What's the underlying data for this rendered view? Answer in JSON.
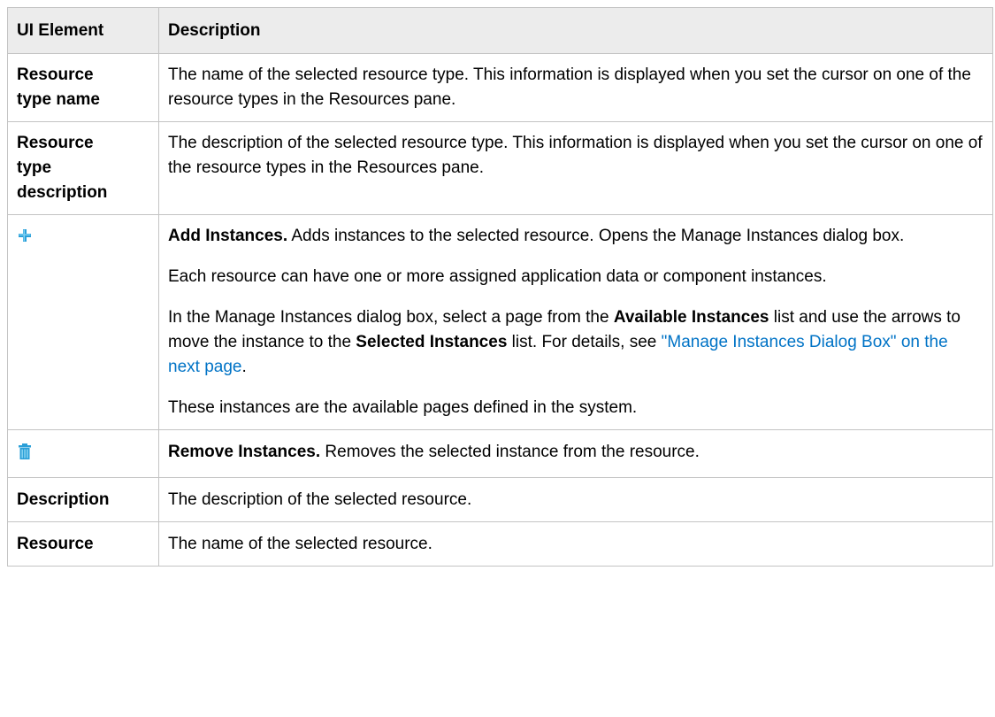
{
  "table": {
    "headers": {
      "element": "UI Element",
      "description": "Description"
    },
    "rows": {
      "resource_type_name": {
        "element_line1": "Resource",
        "element_line2": "type name",
        "description": "The name of the selected resource type. This information is displayed when you set the cursor on one of the resource types in the Resources pane."
      },
      "resource_type_description": {
        "element_line1": "Resource",
        "element_line2": "type",
        "element_line3": "description",
        "description": "The description of the selected resource type. This information is displayed when you set the cursor on one of the resource types in the Resources pane."
      },
      "add_instances": {
        "icon": "plus-icon",
        "lead": "Add Instances.",
        "text1": " Adds instances to the selected resource. Opens the Manage Instances dialog box.",
        "p2": "Each resource can have one or more assigned application data or component instances.",
        "p3_a": "In the Manage Instances dialog box, select a page from the ",
        "p3_b": "Available Instances",
        "p3_c": " list and use the arrows to move the instance to the ",
        "p3_d": "Selected Instances",
        "p3_e": " list. For details, see ",
        "p3_link": "\"Manage Instances Dialog Box\" on the next page",
        "p3_f": ".",
        "p4": "These instances are the available pages defined in the system."
      },
      "remove_instances": {
        "icon": "trash-icon",
        "lead": "Remove Instances.",
        "text": " Removes the selected instance from the resource."
      },
      "description": {
        "element": "Description",
        "description": "The description of the selected resource."
      },
      "resource": {
        "element": "Resource",
        "description": "The name of the selected resource."
      }
    }
  },
  "colors": {
    "header_bg": "#ececec",
    "border": "#c4c4c4",
    "link": "#0073c6",
    "icon_blue": "#2a9fd8"
  }
}
